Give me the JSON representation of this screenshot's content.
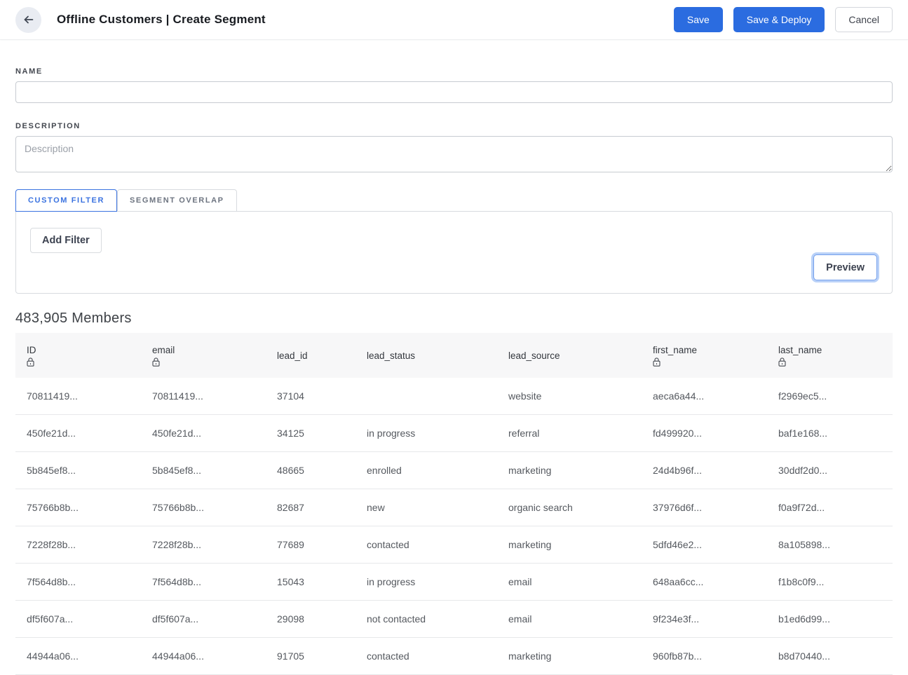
{
  "header": {
    "title": "Offline Customers | Create Segment",
    "back_icon": "arrow-left",
    "save_label": "Save",
    "save_deploy_label": "Save & Deploy",
    "cancel_label": "Cancel",
    "accent_color": "#2b6ce0"
  },
  "form": {
    "name_label": "NAME",
    "name_value": "",
    "description_label": "DESCRIPTION",
    "description_placeholder": "Description",
    "description_value": ""
  },
  "tabs": [
    {
      "label": "CUSTOM FILTER",
      "active": true
    },
    {
      "label": "SEGMENT OVERLAP",
      "active": false
    }
  ],
  "filter_panel": {
    "add_filter_label": "Add Filter",
    "preview_label": "Preview"
  },
  "members": {
    "heading": "483,905 Members",
    "columns": [
      {
        "key": "id",
        "label": "ID",
        "locked": true
      },
      {
        "key": "email",
        "label": "email",
        "locked": true
      },
      {
        "key": "lead_id",
        "label": "lead_id",
        "locked": false
      },
      {
        "key": "lead_status",
        "label": "lead_status",
        "locked": false
      },
      {
        "key": "lead_source",
        "label": "lead_source",
        "locked": false
      },
      {
        "key": "first_name",
        "label": "first_name",
        "locked": true
      },
      {
        "key": "last_name",
        "label": "last_name",
        "locked": true
      }
    ],
    "rows": [
      [
        "70811419...",
        "70811419...",
        "37104",
        "",
        "website",
        "aeca6a44...",
        "f2969ec5..."
      ],
      [
        "450fe21d...",
        "450fe21d...",
        "34125",
        "in progress",
        "referral",
        "fd499920...",
        "baf1e168..."
      ],
      [
        "5b845ef8...",
        "5b845ef8...",
        "48665",
        "enrolled",
        "marketing",
        "24d4b96f...",
        "30ddf2d0..."
      ],
      [
        "75766b8b...",
        "75766b8b...",
        "82687",
        "new",
        "organic search",
        "37976d6f...",
        "f0a9f72d..."
      ],
      [
        "7228f28b...",
        "7228f28b...",
        "77689",
        "contacted",
        "marketing",
        "5dfd46e2...",
        "8a105898..."
      ],
      [
        "7f564d8b...",
        "7f564d8b...",
        "15043",
        "in progress",
        "email",
        "648aa6cc...",
        "f1b8c0f9..."
      ],
      [
        "df5f607a...",
        "df5f607a...",
        "29098",
        "not contacted",
        "email",
        "9f234e3f...",
        "b1ed6d99..."
      ],
      [
        "44944a06...",
        "44944a06...",
        "91705",
        "contacted",
        "marketing",
        "960fb87b...",
        "b8d70440..."
      ]
    ]
  }
}
